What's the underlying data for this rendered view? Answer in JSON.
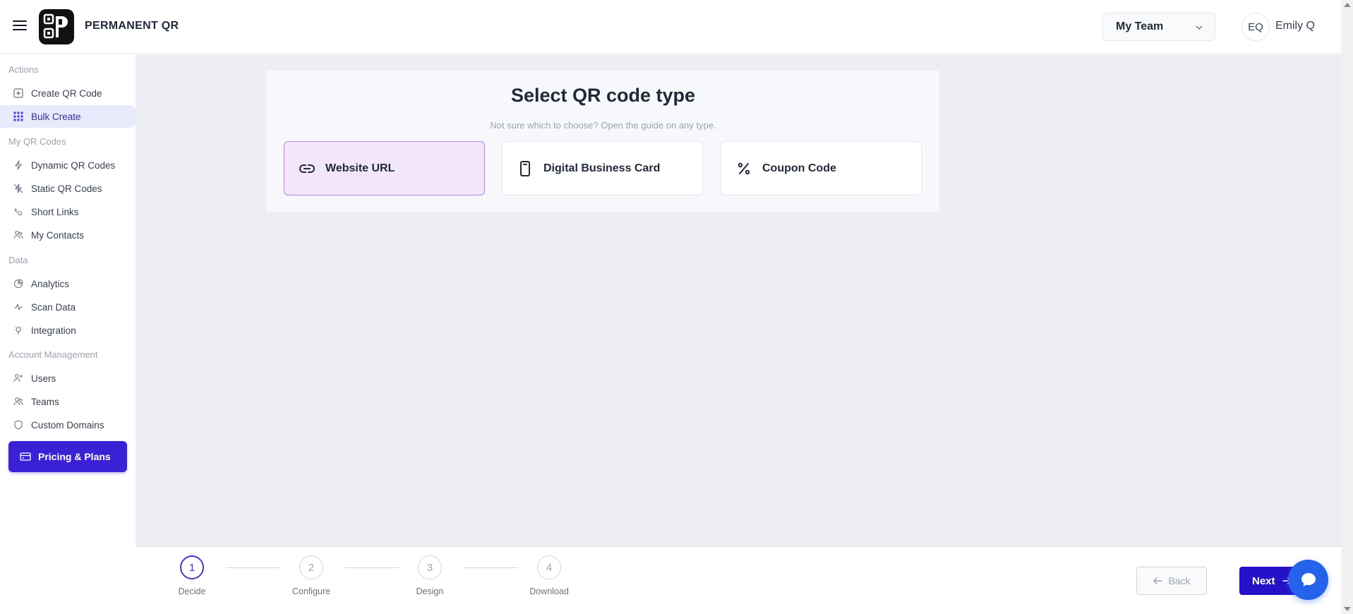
{
  "header": {
    "brand": "PERMANENT QR",
    "team_select": "My Team",
    "avatar_initials": "EQ",
    "user_name": "Emily Q"
  },
  "sidebar": {
    "sections": {
      "actions": "Actions",
      "my_qr_codes": "My QR Codes",
      "data": "Data",
      "account_management": "Account Management"
    },
    "items": {
      "create_qr_code": "Create QR Code",
      "bulk_create": "Bulk Create",
      "dynamic_qr_codes": "Dynamic QR Codes",
      "static_qr_codes": "Static QR Codes",
      "short_links": "Short Links",
      "my_contacts": "My Contacts",
      "analytics": "Analytics",
      "scan_data": "Scan Data",
      "integration": "Integration",
      "users": "Users",
      "teams": "Teams",
      "custom_domains": "Custom Domains"
    },
    "pricing_button": "Pricing & Plans"
  },
  "main": {
    "title": "Select QR code type",
    "subtitle": "Not sure which to choose? Open the guide on any type.",
    "types": [
      {
        "label": "Website URL",
        "icon": "link-icon",
        "selected": true
      },
      {
        "label": "Digital Business Card",
        "icon": "phone-card-icon",
        "selected": false
      },
      {
        "label": "Coupon Code",
        "icon": "percent-icon",
        "selected": false
      }
    ]
  },
  "stepper": {
    "steps": [
      {
        "number": "1",
        "label": "Decide"
      },
      {
        "number": "2",
        "label": "Configure"
      },
      {
        "number": "3",
        "label": "Design"
      },
      {
        "number": "4",
        "label": "Download"
      }
    ],
    "current_step": 1
  },
  "footer": {
    "back_label": "Back",
    "next_label": "Next"
  },
  "colors": {
    "accent": "#2412c9",
    "selected_card_bg": "#f3e6fb",
    "main_bg": "#eceef4",
    "chat_button": "#2563eb"
  }
}
